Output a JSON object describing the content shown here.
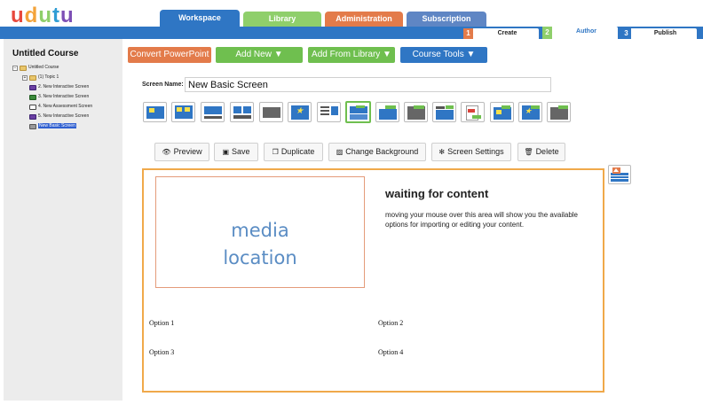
{
  "brand": {
    "logo_text": "udutu",
    "logo_colors": [
      "#e8483c",
      "#f3a33a",
      "#8fcf6b",
      "#2f9dd4",
      "#7d4fb5"
    ]
  },
  "main_tabs": [
    {
      "label": "Workspace",
      "color": "#2f76c4",
      "active": true
    },
    {
      "label": "Library",
      "color": "#8fcf6b"
    },
    {
      "label": "Administration",
      "color": "#e37b4a"
    },
    {
      "label": "Subscription",
      "color": "#5f86c4"
    }
  ],
  "sub_tabs": [
    {
      "num": "1",
      "label": "Create"
    },
    {
      "num": "2",
      "label": "Author",
      "active": true
    },
    {
      "num": "3",
      "label": "Publish"
    }
  ],
  "sidebar": {
    "course_title": "Untitled Course",
    "tree": [
      {
        "label": "Untitled Course"
      },
      {
        "label": "(1) Topic 1"
      },
      {
        "label": "2. New Interactive Screen"
      },
      {
        "label": "3. New Interactive Screen"
      },
      {
        "label": "4. New Assessment Screen"
      },
      {
        "label": "5. New Interactive Screen"
      },
      {
        "label": "New Basic Screen",
        "selected": true
      }
    ]
  },
  "actions": {
    "convert": "Convert PowerPoint",
    "add_new": "Add New ▼",
    "add_from_library": "Add From Library ▼",
    "course_tools": "Course Tools ▼"
  },
  "screen_name": {
    "label": "Screen Name:",
    "value": "New Basic Screen"
  },
  "toolbar": {
    "preview": "Preview",
    "save": "Save",
    "duplicate": "Duplicate",
    "change_background": "Change Background",
    "screen_settings": "Screen Settings",
    "delete": "Delete"
  },
  "canvas": {
    "media_line1": "media",
    "media_line2": "location",
    "waiting_title": "waiting for content",
    "waiting_body": "moving your mouse over this area will show you the available options for importing or editing your content.",
    "option1": "Option 1",
    "option2": "Option 2",
    "option3": "Option 3",
    "option4": "Option 4"
  },
  "colors": {
    "accent_blue": "#2f76c4",
    "accent_green": "#6fbf4f",
    "accent_orange": "#e37b4a",
    "canvas_border": "#f0a94a"
  }
}
